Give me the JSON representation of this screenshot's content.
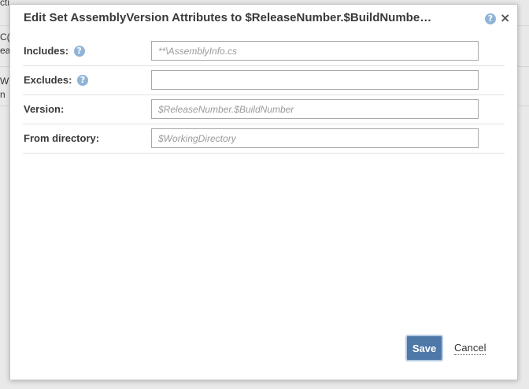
{
  "dialog": {
    "title": "Edit Set AssemblyVersion Attributes to $ReleaseNumber.$BuildNumbe…",
    "help_glyph": "?",
    "close_glyph": "×"
  },
  "fields": [
    {
      "label": "Includes:",
      "has_help": true,
      "value": "",
      "placeholder": "**\\AssemblyInfo.cs"
    },
    {
      "label": "Excludes:",
      "has_help": true,
      "value": "",
      "placeholder": ""
    },
    {
      "label": "Version:",
      "has_help": false,
      "value": "",
      "placeholder": "$ReleaseNumber.$BuildNumber"
    },
    {
      "label": "From directory:",
      "has_help": false,
      "value": "",
      "placeholder": "$WorkingDirectory"
    }
  ],
  "buttons": {
    "save_label": "Save",
    "cancel_label": "Cancel"
  },
  "background": {
    "fragments": [
      "cti",
      "C(",
      "ea",
      "W",
      "n"
    ]
  },
  "colors": {
    "primary_button": "#4e78a8",
    "help_badge": "#8fb4d8"
  }
}
